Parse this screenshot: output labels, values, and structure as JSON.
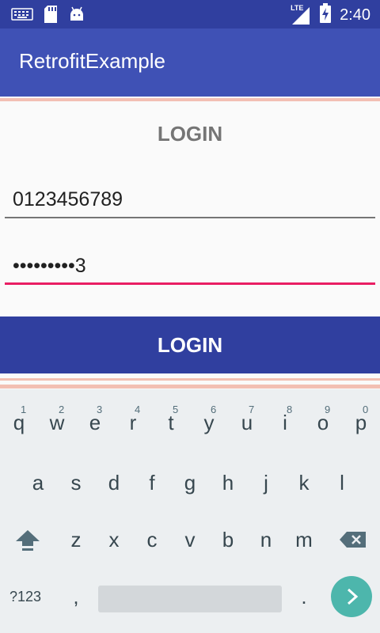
{
  "status_bar": {
    "time": "2:40",
    "network": "LTE",
    "icons": [
      "keyboard-icon",
      "sd-card-icon",
      "android-icon",
      "lte-signal-icon",
      "battery-charging-icon"
    ]
  },
  "app_bar": {
    "title": "RetrofitExample"
  },
  "form": {
    "title": "LOGIN",
    "phone_value": "0123456789",
    "password_value": "•••••••••3",
    "login_button": "LOGIN"
  },
  "keyboard": {
    "row1": [
      {
        "key": "q",
        "num": "1"
      },
      {
        "key": "w",
        "num": "2"
      },
      {
        "key": "e",
        "num": "3"
      },
      {
        "key": "r",
        "num": "4"
      },
      {
        "key": "t",
        "num": "5"
      },
      {
        "key": "y",
        "num": "6"
      },
      {
        "key": "u",
        "num": "7"
      },
      {
        "key": "i",
        "num": "8"
      },
      {
        "key": "o",
        "num": "9"
      },
      {
        "key": "p",
        "num": "0"
      }
    ],
    "row2": [
      "a",
      "s",
      "d",
      "f",
      "g",
      "h",
      "j",
      "k",
      "l"
    ],
    "row3": [
      "z",
      "x",
      "c",
      "v",
      "b",
      "n",
      "m"
    ],
    "symbols_label": "?123",
    "comma": ",",
    "period": ".",
    "colors": {
      "accent": "#4db6ac",
      "background": "#eceff1"
    }
  },
  "colors": {
    "primary": "#3f51b5",
    "primary_dark": "#303f9f",
    "field_focus": "#e91e63"
  }
}
